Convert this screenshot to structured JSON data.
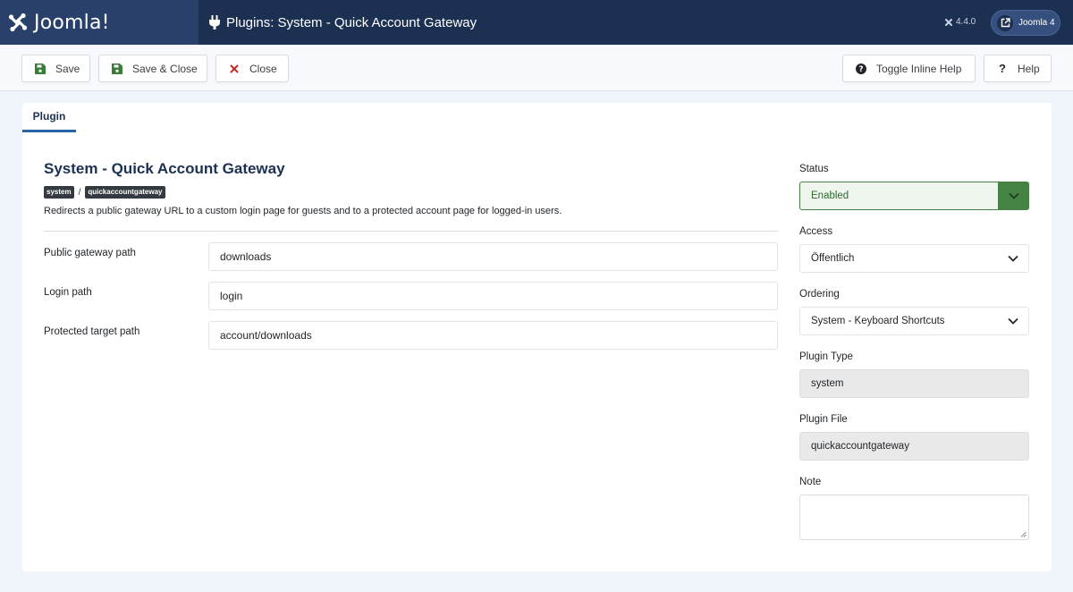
{
  "header": {
    "logo_text": "Joomla!",
    "page_title": "Plugins: System - Quick Account Gateway",
    "version": "4.4.0",
    "site_button_label": "Joomla 4"
  },
  "toolbar": {
    "save_label": "Save",
    "save_close_label": "Save & Close",
    "close_label": "Close",
    "toggle_help_label": "Toggle Inline Help",
    "help_label": "Help"
  },
  "tabs": [
    {
      "label": "Plugin",
      "active": true
    }
  ],
  "plugin": {
    "title": "System - Quick Account Gateway",
    "folder_badge": "system",
    "element_badge": "quickaccountgateway",
    "description": "Redirects a public gateway URL to a custom login page for guests and to a protected account page for logged-in users."
  },
  "fields": [
    {
      "label": "Public gateway path",
      "value": "downloads"
    },
    {
      "label": "Login path",
      "value": "login"
    },
    {
      "label": "Protected target path",
      "value": "account/downloads"
    }
  ],
  "sidebar": {
    "status": {
      "label": "Status",
      "value": "Enabled"
    },
    "access": {
      "label": "Access",
      "value": "Öffentlich"
    },
    "ordering": {
      "label": "Ordering",
      "value": "System - Keyboard Shortcuts"
    },
    "plugin_type": {
      "label": "Plugin Type",
      "value": "system"
    },
    "plugin_file": {
      "label": "Plugin File",
      "value": "quickaccountgateway"
    },
    "note": {
      "label": "Note",
      "value": ""
    }
  },
  "colors": {
    "header_bg": "#1c3152",
    "logo_bg": "#28406a",
    "accent_blue": "#2a64a6",
    "status_green": "#448344",
    "close_red": "#c52827",
    "save_green": "#3a7d3a"
  },
  "icons": {
    "logo": "joomla-logo-icon",
    "title": "plug-icon",
    "save": "floppy-disk-icon",
    "close": "close-icon",
    "toggle_help": "question-circle-icon",
    "help": "question-icon",
    "site": "external-link-icon",
    "select": "chevron-down-icon"
  }
}
